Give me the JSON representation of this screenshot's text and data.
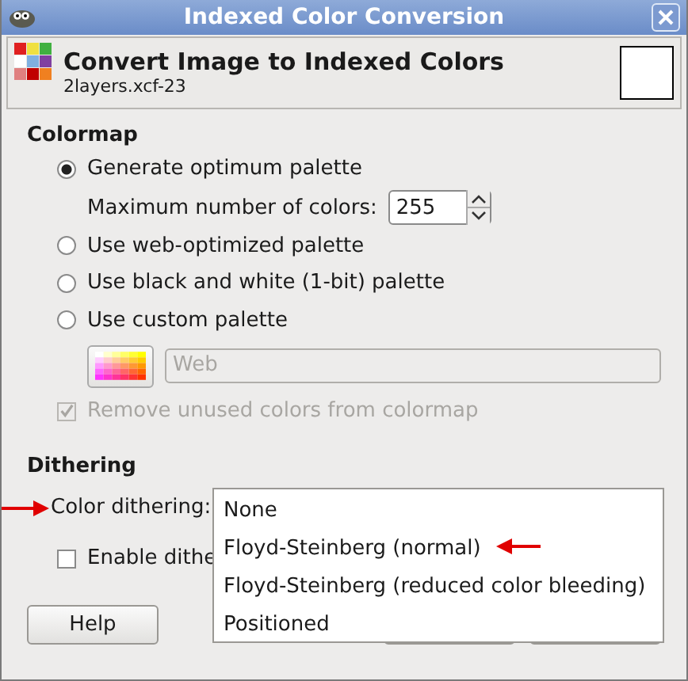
{
  "window": {
    "title": "Indexed Color Conversion"
  },
  "header": {
    "title": "Convert Image to Indexed Colors",
    "subtitle": "2layers.xcf-23"
  },
  "colormap": {
    "heading": "Colormap",
    "options": [
      {
        "label": "Generate optimum palette",
        "selected": true
      },
      {
        "label": "Use web-optimized palette",
        "selected": false
      },
      {
        "label": "Use black and white (1-bit) palette",
        "selected": false
      },
      {
        "label": "Use custom palette",
        "selected": false
      }
    ],
    "max_colors": {
      "label": "Maximum number of colors:",
      "value": "255"
    },
    "palette_field": {
      "value": "Web",
      "disabled": true
    },
    "remove_unused": {
      "label": "Remove unused colors from colormap",
      "checked": true,
      "disabled": true
    }
  },
  "dithering": {
    "heading": "Dithering",
    "color_dithering_label": "Color dithering:",
    "enable_transparency": {
      "label": "Enable dithe",
      "checked": false
    },
    "menu": [
      "None",
      "Floyd-Steinberg (normal)",
      "Floyd-Steinberg (reduced color bleeding)",
      "Positioned"
    ]
  },
  "buttons": [
    "Help"
  ]
}
